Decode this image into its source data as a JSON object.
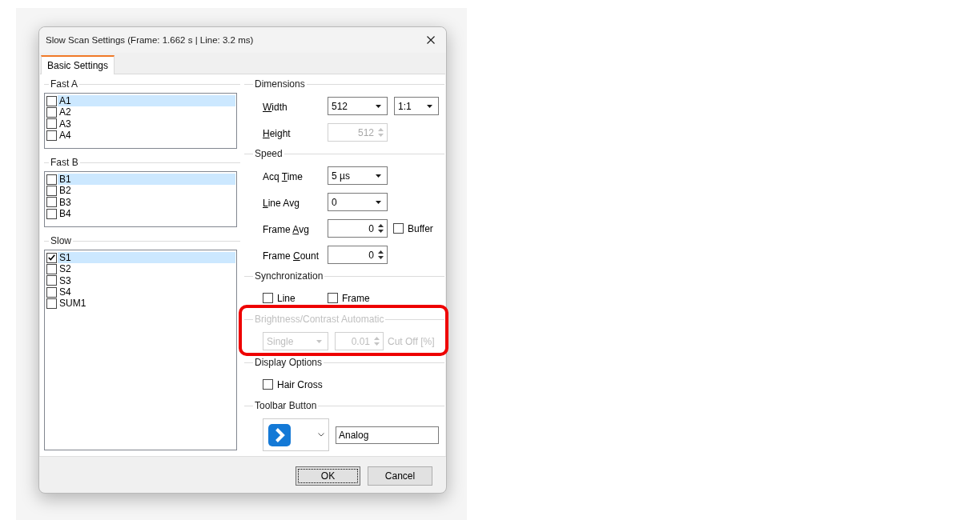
{
  "window": {
    "title": "Slow Scan Settings (Frame: 1.662 s | Line: 3.2 ms)"
  },
  "tabs": [
    {
      "label": "Basic Settings",
      "selected": true
    }
  ],
  "channel_groups": [
    {
      "title": "Fast A",
      "items": [
        {
          "label": "A1",
          "checked": false,
          "selected": true
        },
        {
          "label": "A2",
          "checked": false,
          "selected": false
        },
        {
          "label": "A3",
          "checked": false,
          "selected": false
        },
        {
          "label": "A4",
          "checked": false,
          "selected": false
        }
      ]
    },
    {
      "title": "Fast B",
      "items": [
        {
          "label": "B1",
          "checked": false,
          "selected": true
        },
        {
          "label": "B2",
          "checked": false,
          "selected": false
        },
        {
          "label": "B3",
          "checked": false,
          "selected": false
        },
        {
          "label": "B4",
          "checked": false,
          "selected": false
        }
      ]
    },
    {
      "title": "Slow",
      "items": [
        {
          "label": "S1",
          "checked": true,
          "selected": true
        },
        {
          "label": "S2",
          "checked": false,
          "selected": false
        },
        {
          "label": "S3",
          "checked": false,
          "selected": false
        },
        {
          "label": "S4",
          "checked": false,
          "selected": false
        },
        {
          "label": "SUM1",
          "checked": false,
          "selected": false
        }
      ]
    }
  ],
  "settings_groups": [
    {
      "title": "Dimensions",
      "disabled": false,
      "rows": [
        {
          "kind": "field",
          "label": [
            {
              "text": "W",
              "underlined": true
            },
            {
              "text": "idth",
              "underlined": false
            }
          ],
          "controls": [
            {
              "kind": "combo",
              "value": "512",
              "disabled": false
            },
            {
              "kind": "combo",
              "value": "1:1",
              "disabled": false
            }
          ]
        },
        {
          "kind": "field",
          "label": [
            {
              "text": "H",
              "underlined": true
            },
            {
              "text": "eight",
              "underlined": false
            }
          ],
          "controls": [
            {
              "kind": "spin",
              "value": "512",
              "disabled": true
            }
          ]
        }
      ]
    },
    {
      "title": "Speed",
      "disabled": false,
      "rows": [
        {
          "kind": "field",
          "label": [
            {
              "text": "Acq ",
              "underlined": false
            },
            {
              "text": "T",
              "underlined": true
            },
            {
              "text": "ime",
              "underlined": false
            }
          ],
          "controls": [
            {
              "kind": "combo",
              "value": "5 µs",
              "disabled": false
            }
          ]
        },
        {
          "kind": "field",
          "label": [
            {
              "text": "L",
              "underlined": true
            },
            {
              "text": "ine Avg",
              "underlined": false
            }
          ],
          "controls": [
            {
              "kind": "combo",
              "value": "0",
              "disabled": false
            }
          ]
        },
        {
          "kind": "field",
          "label": [
            {
              "text": "Frame ",
              "underlined": false
            },
            {
              "text": "A",
              "underlined": true
            },
            {
              "text": "vg",
              "underlined": false
            }
          ],
          "controls": [
            {
              "kind": "spin",
              "value": "0",
              "disabled": false
            },
            {
              "kind": "checkbox",
              "label": "Buffer",
              "checked": false
            }
          ]
        },
        {
          "kind": "field",
          "label": [
            {
              "text": "Frame ",
              "underlined": false
            },
            {
              "text": "C",
              "underlined": true
            },
            {
              "text": "ount",
              "underlined": false
            }
          ],
          "controls": [
            {
              "kind": "spin",
              "value": "0",
              "disabled": false
            }
          ]
        }
      ]
    },
    {
      "title": "Synchronization",
      "disabled": false,
      "rows": [
        {
          "kind": "checks",
          "controls": [
            {
              "kind": "checkbox",
              "label": "Line",
              "checked": false
            },
            {
              "kind": "checkbox",
              "label": "Frame",
              "checked": false
            }
          ]
        }
      ]
    },
    {
      "title": "Brightness/Contrast Automatic",
      "disabled": true,
      "highlighted": true,
      "rows": [
        {
          "kind": "controls",
          "controls": [
            {
              "kind": "combo",
              "value": "Single",
              "disabled": true
            },
            {
              "kind": "spin",
              "value": "0.01",
              "disabled": true
            },
            {
              "kind": "caption",
              "text": "Cut Off [%]"
            }
          ]
        }
      ]
    },
    {
      "title": "Display Options",
      "disabled": false,
      "rows": [
        {
          "kind": "checks",
          "controls": [
            {
              "kind": "checkbox",
              "label": "Hair Cross",
              "checked": false
            }
          ]
        }
      ]
    },
    {
      "title": "Toolbar Button",
      "disabled": false,
      "rows": [
        {
          "kind": "controls",
          "controls": [
            {
              "kind": "icon-picker"
            },
            {
              "kind": "text",
              "value": "Analog"
            }
          ]
        }
      ]
    }
  ],
  "buttons": [
    {
      "label": "OK",
      "default": true
    },
    {
      "label": "Cancel",
      "default": false
    }
  ]
}
